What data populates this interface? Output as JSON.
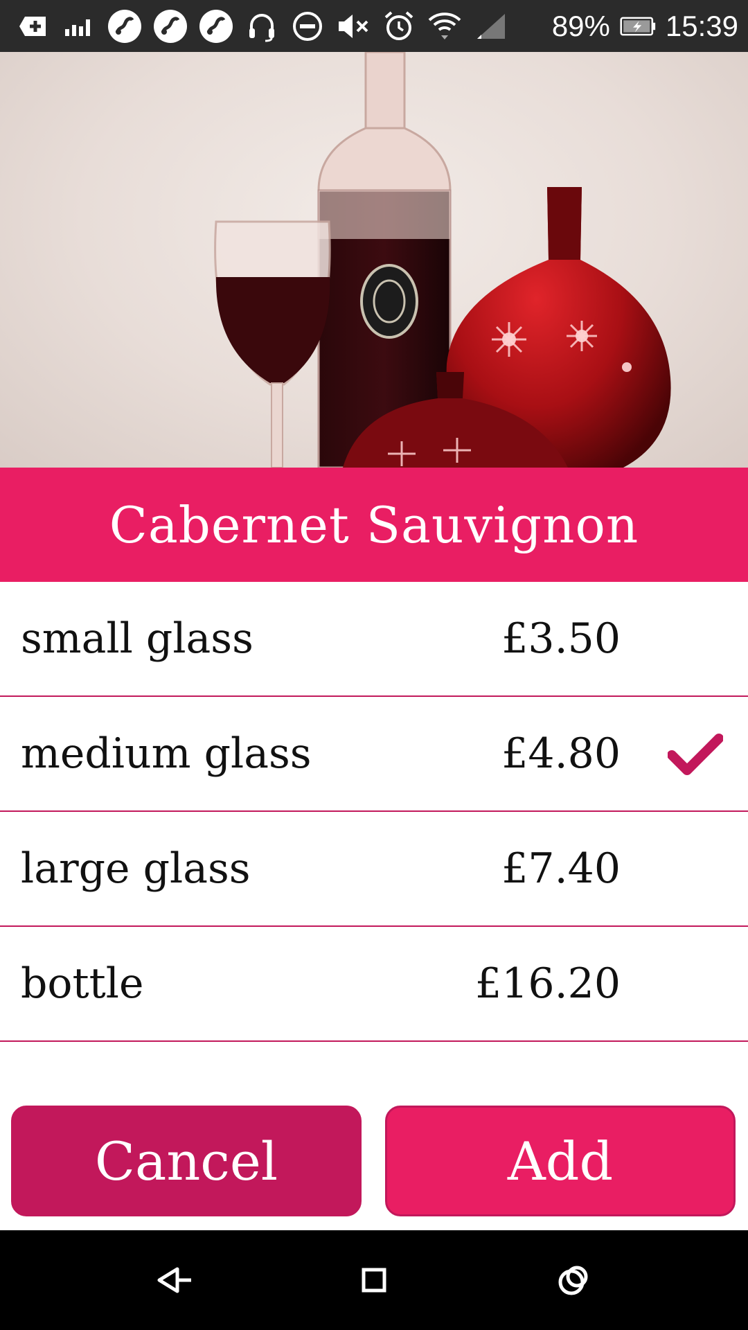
{
  "status_bar": {
    "battery": "89%",
    "time": "15:39",
    "icons": [
      "add-box-icon",
      "signal-bars-icon",
      "app-icon",
      "app-icon",
      "app-icon",
      "headset-icon",
      "do-not-disturb-icon",
      "mute-icon",
      "alarm-icon",
      "wifi-icon",
      "cell-signal-icon",
      "battery-charging-icon"
    ]
  },
  "product": {
    "title": "Cabernet Sauvignon",
    "image": "wine-bottle-glass-vases-photo"
  },
  "options": [
    {
      "label": "small glass",
      "price": "£3.50",
      "selected": false
    },
    {
      "label": "medium glass",
      "price": "£4.80",
      "selected": true
    },
    {
      "label": "large glass",
      "price": "£7.40",
      "selected": false
    },
    {
      "label": "bottle",
      "price": "£16.20",
      "selected": false
    }
  ],
  "buttons": {
    "cancel": "Cancel",
    "add": "Add"
  },
  "colors": {
    "accent": "#e91e63",
    "accent_dark": "#c2185b",
    "status_bar": "#2b2b2b",
    "nav_bar": "#000000"
  },
  "nav": [
    "back-icon",
    "home-icon",
    "recents-icon"
  ]
}
